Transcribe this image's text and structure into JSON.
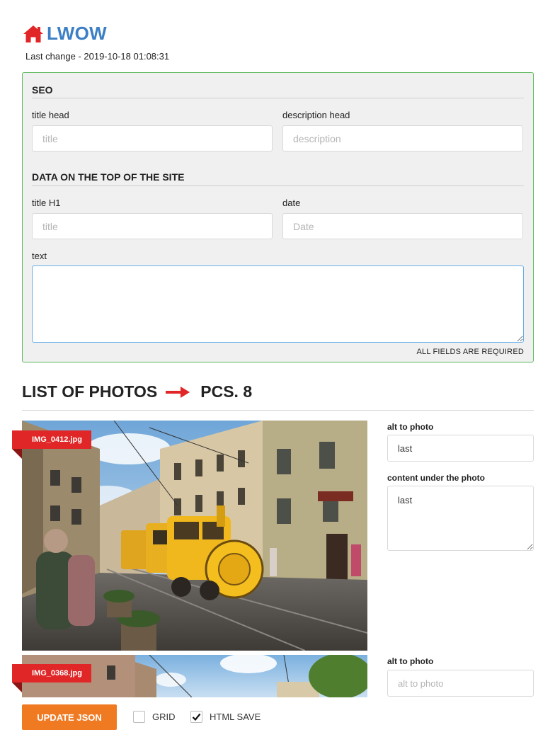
{
  "header": {
    "title": "LWOW",
    "last_change": "Last change - 2019-10-18 01:08:31",
    "icon": "home-icon",
    "accent_color": "#e02626",
    "title_color": "#3b7fc4"
  },
  "seo": {
    "heading": "SEO",
    "title_head": {
      "label": "title head",
      "placeholder": "title",
      "value": ""
    },
    "description_head": {
      "label": "description head",
      "placeholder": "description",
      "value": ""
    }
  },
  "top_data": {
    "heading": "DATA ON THE TOP OF THE SITE",
    "title_h1": {
      "label": "title H1",
      "placeholder": "title",
      "value": ""
    },
    "date": {
      "label": "date",
      "placeholder": "Date",
      "value": ""
    },
    "text": {
      "label": "text",
      "value": ""
    },
    "required_note": "ALL FIELDS ARE REQUIRED"
  },
  "photos": {
    "title": "LIST OF PHOTOS",
    "count": "PCS. 8",
    "arrow_icon": "arrow-right-icon",
    "items": [
      {
        "filename": "IMG_0412.jpg",
        "alt_label": "alt to photo",
        "alt_value": "last",
        "alt_placeholder": "alt to photo",
        "content_label": "content under the photo",
        "content_value": "last"
      },
      {
        "filename": "IMG_0368.jpg",
        "alt_label": "alt to photo",
        "alt_value": "",
        "alt_placeholder": "alt to photo"
      }
    ]
  },
  "footer": {
    "update_button": "UPDATE JSON",
    "button_color": "#f07a22",
    "grid": {
      "label": "GRID",
      "checked": false
    },
    "html_save": {
      "label": "HTML SAVE",
      "checked": true
    }
  }
}
